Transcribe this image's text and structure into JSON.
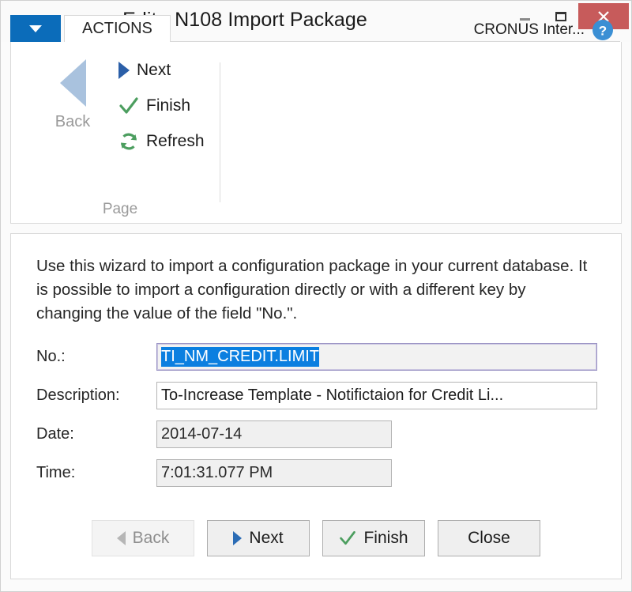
{
  "window": {
    "title": "Edit - N108 Import Package",
    "controls": {
      "minimize": "minimize-button",
      "maximize": "maximize-button",
      "close": "close-button"
    }
  },
  "ribbon": {
    "app_button": "application-menu",
    "tabs": [
      {
        "label": "ACTIONS",
        "active": true
      }
    ],
    "company": "CRONUS Inter...",
    "help": "help-icon",
    "groups": [
      {
        "name": "Page",
        "big_button": {
          "label": "Back",
          "icon": "back-arrow-icon",
          "disabled": true
        },
        "buttons": [
          {
            "label": "Next",
            "icon": "next-arrow-icon"
          },
          {
            "label": "Finish",
            "icon": "checkmark-icon"
          },
          {
            "label": "Refresh",
            "icon": "refresh-icon"
          }
        ]
      }
    ]
  },
  "content": {
    "intro": "Use this wizard to import a configuration package in your current database. It is possible to import a configuration directly or with a different key by changing the value of the field \"No.\".",
    "fields": [
      {
        "label": "No.:",
        "value": "TI_NM_CREDIT.LIMIT",
        "state": "focused-selected"
      },
      {
        "label": "Description:",
        "value": "To-Increase Template - Notifictaion for Credit Li...",
        "state": "editable"
      },
      {
        "label": "Date:",
        "value": "2014-07-14",
        "state": "readonly"
      },
      {
        "label": "Time:",
        "value": "7:01:31.077 PM",
        "state": "readonly"
      }
    ]
  },
  "footer": {
    "buttons": [
      {
        "label": "Back",
        "icon": "back-arrow-icon",
        "disabled": true
      },
      {
        "label": "Next",
        "icon": "next-arrow-icon",
        "disabled": false
      },
      {
        "label": "Finish",
        "icon": "checkmark-icon",
        "disabled": false
      },
      {
        "label": "Close",
        "icon": "none",
        "disabled": false
      }
    ]
  },
  "colors": {
    "accent_blue": "#0b6cba",
    "close_red": "#c75b5b",
    "selection_blue": "#0b7fe0",
    "success_green": "#4c9e5f",
    "next_blue": "#2b5fa8",
    "disabled_gray": "#9a9a9a"
  }
}
